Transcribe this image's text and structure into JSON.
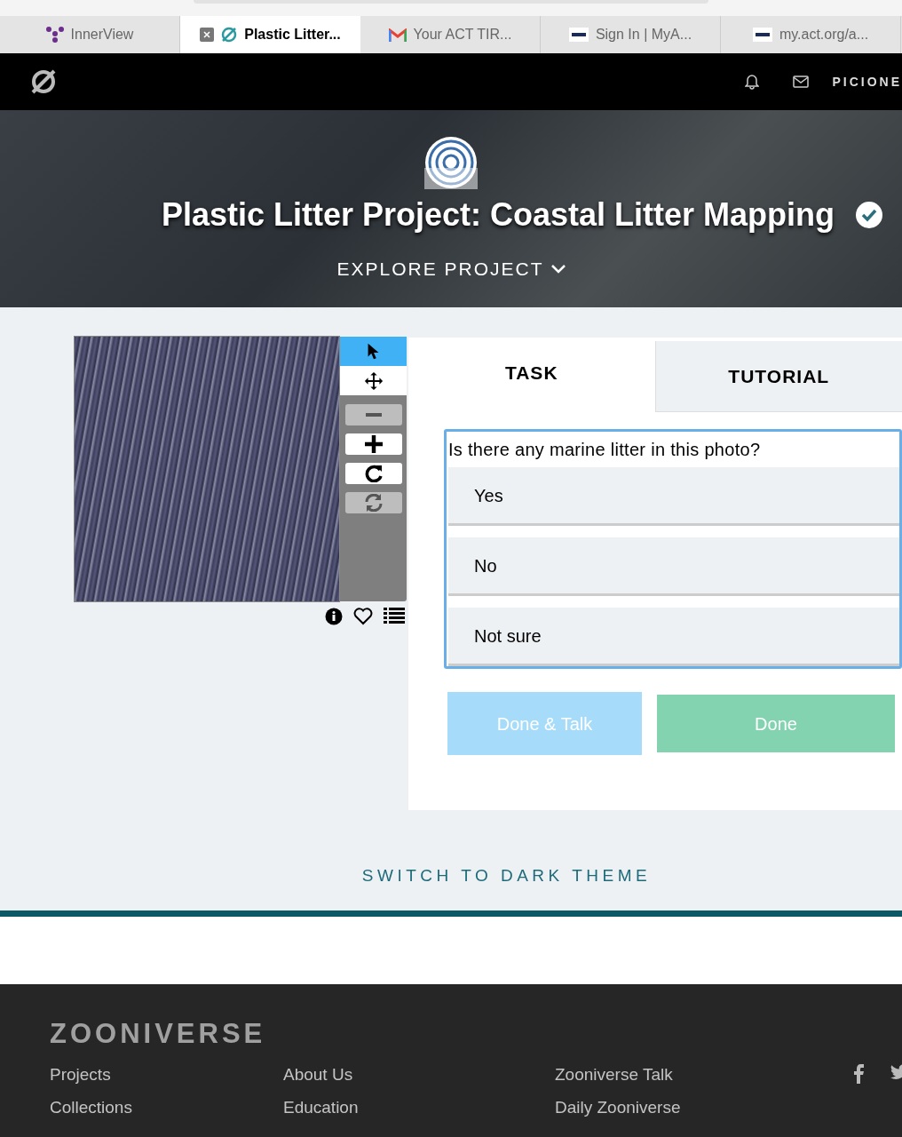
{
  "browser_tabs": [
    {
      "title": "InnerView",
      "selected": false
    },
    {
      "title": "Plastic Litter...",
      "selected": true
    },
    {
      "title": "Your ACT TIR...",
      "selected": false
    },
    {
      "title": "Sign In | MyA...",
      "selected": false
    },
    {
      "title": "my.act.org/a...",
      "selected": false
    }
  ],
  "nav": {
    "user": "PICIONE"
  },
  "hero": {
    "title": "Plastic Litter Project: Coastal Litter Mapping",
    "verified": true,
    "explore": "EXPLORE PROJECT"
  },
  "toolbar": [
    {
      "selected": true,
      "disabled": false
    },
    {
      "selected": false,
      "disabled": false
    },
    {
      "selected": false,
      "disabled": true
    },
    {
      "selected": false,
      "disabled": false
    },
    {
      "selected": false,
      "disabled": false
    },
    {
      "selected": false,
      "disabled": true
    }
  ],
  "panel_tabs": [
    {
      "label": "TASK",
      "selected": true
    },
    {
      "label": "TUTORIAL",
      "selected": false
    }
  ],
  "task": {
    "question": "Is there any marine litter in this photo?",
    "answers": [
      {
        "label": "Yes",
        "selected": false
      },
      {
        "label": "No",
        "selected": false
      },
      {
        "label": "Not sure",
        "selected": false
      }
    ]
  },
  "buttons": [
    {
      "label": "Done & Talk",
      "disabled": true
    },
    {
      "label": "Done",
      "disabled": true
    }
  ],
  "theme_toggle": "SWITCH TO DARK THEME",
  "footer": {
    "logo": "ZOONIVERSE",
    "columns": [
      [
        "Projects",
        "Collections"
      ],
      [
        "About Us",
        "Education"
      ],
      [
        "Zooniverse Talk",
        "Daily Zooniverse"
      ]
    ]
  }
}
